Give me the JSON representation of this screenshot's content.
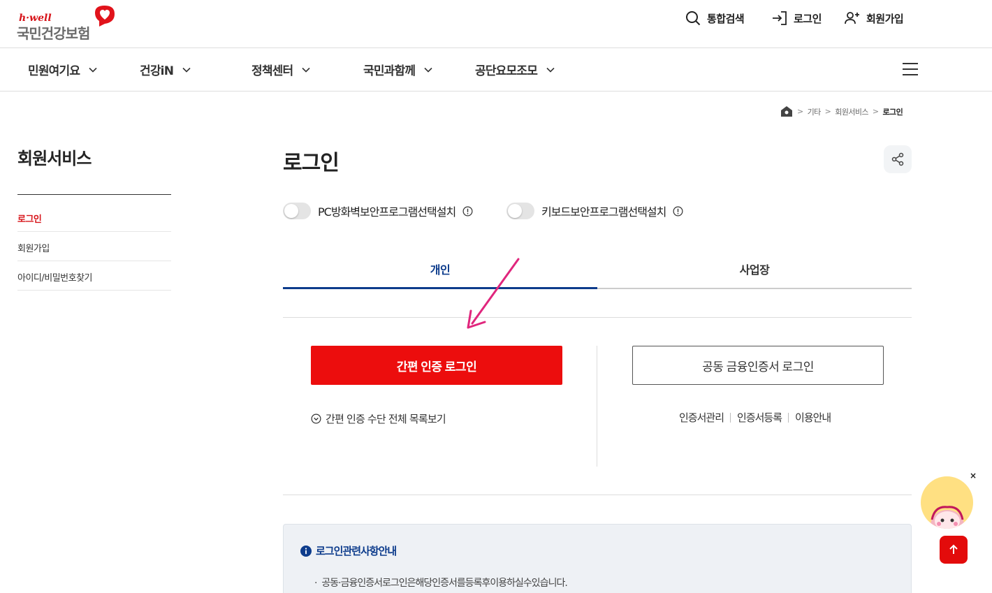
{
  "logo": {
    "en": "h·well",
    "ko": "국민건강보험"
  },
  "util": {
    "search": "통합검색",
    "login": "로그인",
    "join": "회원가입"
  },
  "gnb": {
    "items": [
      "민원여기요",
      "건강iN",
      "정책센터",
      "국민과함께",
      "공단요모조모"
    ]
  },
  "breadcrumb": {
    "items": [
      "기타",
      "회원서비스",
      "로그인"
    ]
  },
  "side": {
    "title": "회원서비스",
    "items": [
      "로그인",
      "회원가입",
      "아이디/비밀번호찾기"
    ],
    "active_index": 0
  },
  "main": {
    "title": "로그인",
    "toggles": [
      "PC방화벽보안프로그램선택설치",
      "키보드보안프로그램선택설치"
    ],
    "tabs": [
      "개인",
      "사업장"
    ],
    "simple_login": "간편 인증 로그인",
    "simple_list": "간편 인증 수단 전체 목록보기",
    "cert_login": "공동 금융인증서 로그인",
    "cert_links": [
      "인증서관리",
      "인증서등록",
      "이용안내"
    ]
  },
  "notice": {
    "title": "로그인관련사항안내",
    "body": "공동·금융인증서로그인은해당인증서를등록후이용하실수있습니다."
  },
  "floating": {
    "close": "×"
  },
  "colors": {
    "brand_red": "#ec0d0d",
    "navy": "#0d3c8c",
    "arrow": "#e0267d"
  },
  "icons": [
    "search-icon",
    "login-icon",
    "user-plus-icon",
    "chevron-down-icon",
    "hamburger-icon",
    "home-icon",
    "share-icon",
    "info-icon",
    "arrow-up-icon"
  ]
}
